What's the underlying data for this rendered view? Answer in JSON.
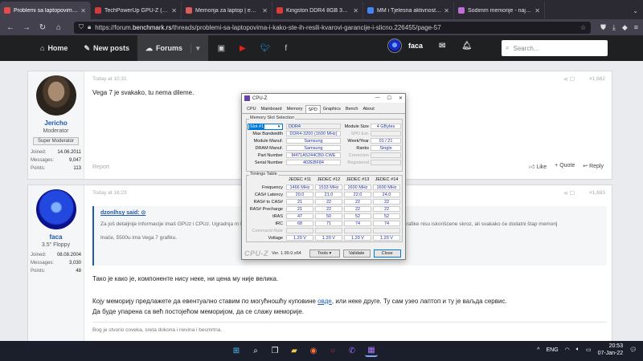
{
  "browser": {
    "tabs": [
      {
        "label": "Problemi sa laptopovima i ka",
        "color": "#e84a4a",
        "active": true
      },
      {
        "label": "TechPowerUp GPU-Z (v2.43.0)",
        "color": "#d33c3c",
        "active": false
      },
      {
        "label": "Memorija za laptop | ePonuda",
        "color": "#e05a5a",
        "active": false
      },
      {
        "label": "Kingston DDR4 8GB 3200MHz",
        "color": "#d93a3a",
        "active": false
      },
      {
        "label": "MM i Tjelesna aktivnost - Pric",
        "color": "#4285f4",
        "active": false
      },
      {
        "label": "Sodimm memorije - najpovolj",
        "color": "#c06fd8",
        "active": false
      }
    ],
    "url_prefix": "https://forum.",
    "url_domain": "benchmark.rs",
    "url_path": "/threads/problemi-sa-laptopovima-i-kako-ste-ih-resili-kvarovi-garancije-i-slicno.226455/page-57"
  },
  "forum": {
    "nav": {
      "home": "Home",
      "new_posts": "New posts",
      "forums": "Forums"
    },
    "user": "faca",
    "search_placeholder": "Search..."
  },
  "post1": {
    "time": "Today at 10:31",
    "number": "#1,682",
    "body": "Vega 7 je svakako, tu nema dileme.",
    "author": "Jericho",
    "title": "Moderator",
    "badge": "Super Moderator",
    "stats": [
      {
        "k": "Joined:",
        "v": "14.06.2011"
      },
      {
        "k": "Messages:",
        "v": "9,047"
      },
      {
        "k": "Points:",
        "v": "113"
      }
    ],
    "report": "Report",
    "actions": {
      "like": "Like",
      "quote": "+ Quote",
      "reply": "Reply"
    }
  },
  "post2": {
    "time": "Today at 16:23",
    "number": "#1,683",
    "author": "faca",
    "title": "3.5\" Floppy",
    "stats": [
      {
        "k": "Joined:",
        "v": "08.08.2004"
      },
      {
        "k": "Messages:",
        "v": "3,030"
      },
      {
        "k": "Points:",
        "v": "48"
      }
    ],
    "quote_head": "dzonlhsy said: ⊙",
    "quote_text": "Za još detaljnije informacije imaš GPUz i CPUz. Ugradnja m                                                                                     le. Malo je slab CL te memorije (22) pa čak ni sada performanse Vega grafike nisu iskorišćene skroz, ali svakako će dodatni štap memorij",
    "quote_text2": "Inače, 5500u ima Vega 7 grafiku.",
    "line1": "Тако је како је, компоненте нису неке, ни цена му није велика.",
    "line2": "Коју меморију предлажете да евентуално ставим по могућношћу куповине ",
    "line2_link": "овде",
    "line2_end": ", или неке друге. Ту сам узео лаптоп и ту је ваљда сервис.",
    "line3": "Да буде упарена са већ постојећом меморијом, да се слажу меморије.",
    "signature": "Bog je stvorio coveka, sreta dokona i nevina i besmrtna."
  },
  "cpuz": {
    "title": "CPU-Z",
    "tabs": [
      "CPU",
      "Mainboard",
      "Memory",
      "SPD",
      "Graphics",
      "Bench",
      "About"
    ],
    "slot_group": "Memory Slot Selection",
    "slot": "Slot #1",
    "type": "DDR4",
    "module_size_label": "Module Size",
    "module_size": "4 GBytes",
    "max_bw_label": "Max Bandwidth",
    "max_bw": "DDR4-3200 (1600 MHz)",
    "spd_ext_label": "SPD Ext.",
    "manuf_label": "Module Manuf.",
    "manuf": "Samsung",
    "week_year_label": "Week/Year",
    "week_year": "01 / 21",
    "dram_label": "DRAM Manuf.",
    "dram": "Samsung",
    "ranks_label": "Ranks",
    "ranks": "Single",
    "part_label": "Part Number",
    "part": "M471A5244CB0-CWE",
    "correction_label": "Correction",
    "serial_label": "Serial Number",
    "serial": "402EBF84",
    "registered_label": "Registered",
    "timings_group": "Timings Table",
    "cols": [
      "JEDEC #11",
      "JEDEC #12",
      "JEDEC #13",
      "JEDEC #14"
    ],
    "rows": [
      {
        "label": "Frequency",
        "vals": [
          "1466 MHz",
          "1533 MHz",
          "1600 MHz",
          "1600 MHz"
        ]
      },
      {
        "label": "CAS# Latency",
        "vals": [
          "20.0",
          "21.0",
          "22.0",
          "24.0"
        ]
      },
      {
        "label": "RAS# to CAS#",
        "vals": [
          "21",
          "22",
          "22",
          "22"
        ]
      },
      {
        "label": "RAS# Precharge",
        "vals": [
          "21",
          "22",
          "22",
          "22"
        ]
      },
      {
        "label": "tRAS",
        "vals": [
          "47",
          "50",
          "52",
          "52"
        ]
      },
      {
        "label": "tRC",
        "vals": [
          "68",
          "71",
          "74",
          "74"
        ]
      },
      {
        "label": "Command Rate",
        "vals": [
          "",
          "",
          "",
          ""
        ]
      },
      {
        "label": "Voltage",
        "vals": [
          "1.20 V",
          "1.20 V",
          "1.20 V",
          "1.20 V"
        ]
      }
    ],
    "logo": "CPU-Z",
    "version": "Ver. 1.99.0.x64",
    "tools": "Tools",
    "validate": "Validate",
    "close": "Close"
  },
  "taskbar": {
    "lang": "ENG",
    "time": "20:53",
    "date": "07-Jan-22"
  }
}
